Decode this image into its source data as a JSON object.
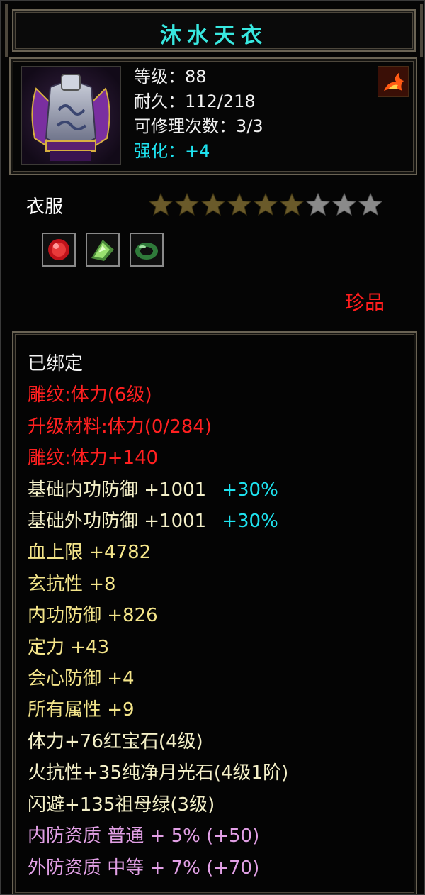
{
  "item": {
    "name": "沐水天衣",
    "level": "等级：88",
    "durability": "耐久：112/218",
    "repairs": "可修理次数：3/3",
    "enhance": "强化：+4",
    "type": "衣服",
    "stars_total": 9,
    "stars_filled": 6,
    "rarity": "珍品",
    "icon": "armor-icon",
    "badge_icon": "flame-icon",
    "gem_icons": [
      "ruby-gem-icon",
      "moonstone-gem-icon",
      "jade-ring-icon"
    ]
  },
  "details": [
    {
      "text": "已绑定",
      "color": "white"
    },
    {
      "text": "雕纹:体力(6级)",
      "color": "red"
    },
    {
      "text": "升级材料:体力(0/284)",
      "color": "red"
    },
    {
      "text": "雕纹:体力+140",
      "color": "red"
    },
    {
      "text": "基础内功防御 +1001",
      "pct": "+30%",
      "color": "pale"
    },
    {
      "text": "基础外功防御 +1001",
      "pct": "+30%",
      "color": "pale"
    },
    {
      "text": "血上限 +4782",
      "color": "yellow"
    },
    {
      "text": "玄抗性 +8",
      "color": "yellow"
    },
    {
      "text": "内功防御 +826",
      "color": "yellow"
    },
    {
      "text": "定力 +43",
      "color": "yellow"
    },
    {
      "text": "会心防御 +4",
      "color": "yellow"
    },
    {
      "text": "所有属性 +9",
      "color": "yellow"
    },
    {
      "text": "体力+76红宝石(4级)",
      "color": "pale"
    },
    {
      "text": "火抗性+35纯净月光石(4级1阶)",
      "color": "pale"
    },
    {
      "text": "闪避+135祖母绿(3级)",
      "color": "pale"
    },
    {
      "text": "内防资质 普通 + 5% (+50)",
      "color": "pink"
    },
    {
      "text": "外防资质 中等 + 7% (+70)",
      "color": "pink"
    }
  ],
  "colors": {
    "title": "#38e8e0",
    "enhance": "#1ee3f0",
    "red": "#ff2020",
    "yellow": "#f4e58a",
    "pink": "#e2a0e6",
    "star_filled": "#6a5a2a",
    "star_empty": "#8a8a8a"
  }
}
